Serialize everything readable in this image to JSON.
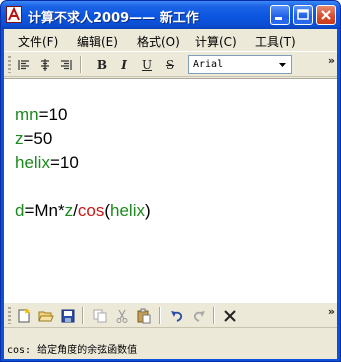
{
  "window": {
    "title": "计算不求人2009—— 新工作"
  },
  "menu": {
    "items": [
      "文件(F)",
      "编辑(E)",
      "格式(O)",
      "计算(C)",
      "工具(T)"
    ]
  },
  "format_toolbar": {
    "buttons": [
      "align-left",
      "align-center",
      "align-right",
      "bold",
      "italic",
      "underline",
      "strikethrough"
    ],
    "bold_label": "B",
    "italic_label": "I",
    "underline_label": "U",
    "strike_label": "S",
    "font_value": "Arial",
    "overflow": "»"
  },
  "editor": {
    "colors": {
      "variable": "#1c8a1c",
      "function": "#c81818",
      "text": "#000000"
    },
    "line1": {
      "var": "mn",
      "rest": "=10"
    },
    "line2": {
      "var": "z",
      "rest": "=50"
    },
    "line3": {
      "var": "helix",
      "rest": "=10"
    },
    "line4": {
      "var_d": "d",
      "eq": "=Mn*",
      "var_z": "z",
      "slash": "/",
      "func": "cos",
      "open": "(",
      "var_helix": "helix",
      "close": ")"
    }
  },
  "file_toolbar": {
    "buttons": [
      "new-file-icon",
      "open-folder-icon",
      "save-icon",
      "copy-icon",
      "cut-icon",
      "paste-icon",
      "undo-icon",
      "redo-icon",
      "delete-icon"
    ],
    "overflow": "»"
  },
  "status": {
    "text": "cos: 给定角度的余弦函数值"
  }
}
